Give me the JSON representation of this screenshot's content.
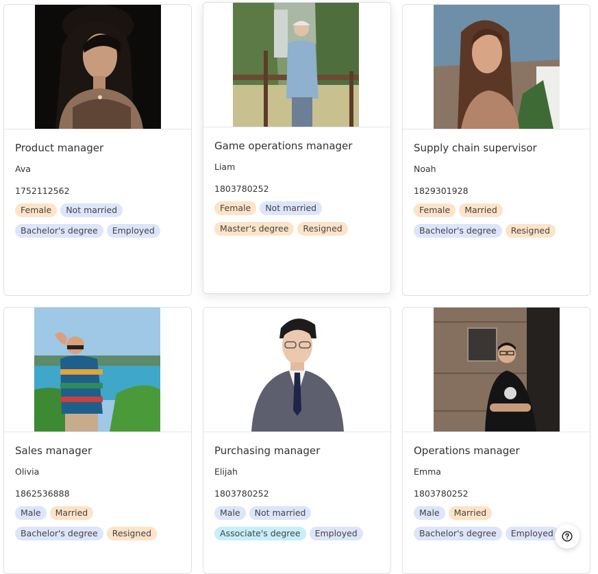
{
  "colors": {
    "tag_blue": "#dde5fb",
    "tag_orange": "#fde3c8",
    "tag_cyan": "#c7eef9",
    "card_border": "#dcdfe6"
  },
  "cards": [
    {
      "title": "Product manager",
      "name": "Ava",
      "phone": "1752112562",
      "tags_row1": [
        "Female",
        "Not married"
      ],
      "tags_row2": [
        "Bachelor's degree",
        "Employed"
      ]
    },
    {
      "title": "Game operations manager",
      "name": "Liam",
      "phone": "1803780252",
      "tags_row1": [
        "Female",
        "Not married"
      ],
      "tags_row2": [
        "Master's degree",
        "Resigned"
      ]
    },
    {
      "title": "Supply chain supervisor",
      "name": "Noah",
      "phone": "1829301928",
      "tags_row1": [
        "Female",
        "Married"
      ],
      "tags_row2": [
        "Bachelor's degree",
        "Resigned"
      ]
    },
    {
      "title": "Sales manager",
      "name": "Olivia",
      "phone": "1862536888",
      "tags_row1": [
        "Male",
        "Married"
      ],
      "tags_row2": [
        "Bachelor's degree",
        "Resigned"
      ]
    },
    {
      "title": "Purchasing manager",
      "name": "Elijah",
      "phone": "1803780252",
      "tags_row1": [
        "Male",
        "Not married"
      ],
      "tags_row2": [
        "Associate's degree",
        "Employed"
      ]
    },
    {
      "title": "Operations manager",
      "name": "Emma",
      "phone": "1803780252",
      "tags_row1": [
        "Male",
        "Married"
      ],
      "tags_row2": [
        "Bachelor's degree",
        "Employed"
      ]
    }
  ],
  "help_button": {
    "icon": "question-circle-icon"
  }
}
